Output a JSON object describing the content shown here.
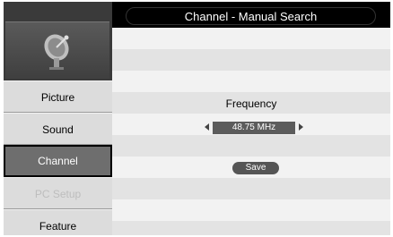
{
  "header": {
    "title": "Channel - Manual Search"
  },
  "sidebar": {
    "icon": "satellite-dish-icon",
    "items": [
      {
        "label": "Picture",
        "state": "normal"
      },
      {
        "label": "Sound",
        "state": "normal"
      },
      {
        "label": "Channel",
        "state": "active"
      },
      {
        "label": "PC Setup",
        "state": "disabled"
      },
      {
        "label": "Feature",
        "state": "normal"
      }
    ]
  },
  "main": {
    "frequency_label": "Frequency",
    "frequency_value": "48.75 MHz",
    "save_label": "Save"
  },
  "colors": {
    "frame": "#000000",
    "sidebar_item": "#dcdcdc",
    "sidebar_active": "#6e6e6e",
    "row_light": "#f2f2f2",
    "row_dark": "#e3e3e3",
    "value_box": "#5c5c5c"
  }
}
